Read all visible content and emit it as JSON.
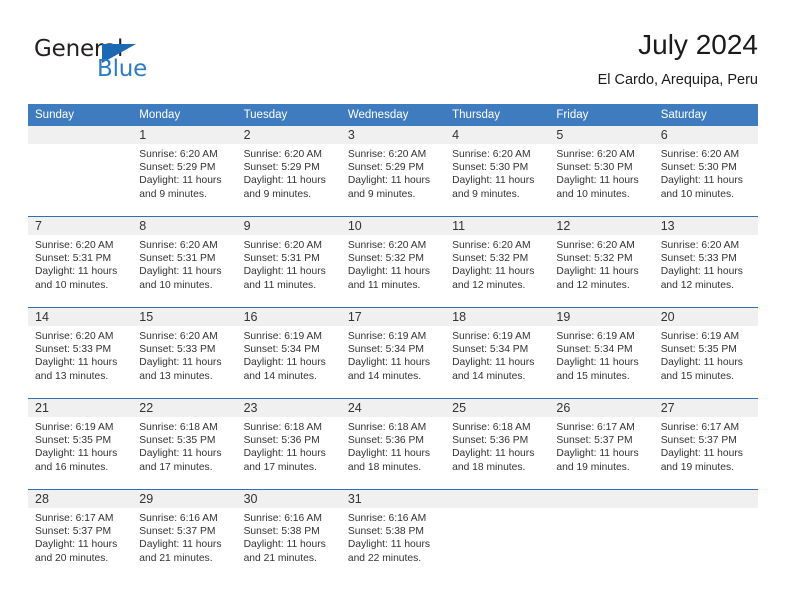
{
  "logo": {
    "primary_text": "General",
    "secondary_text": "Blue",
    "primary_color": "#231f20",
    "secondary_color": "#2b7cc4",
    "triangle_color": "#1b69b3"
  },
  "header": {
    "title": "July 2024",
    "subtitle": "El Cardo, Arequipa, Peru"
  },
  "theme": {
    "header_row_bg": "#3f7cbf",
    "header_row_text": "#ffffff",
    "daynum_bg": "#f0f0f0",
    "row_divider": "#2f6fb3",
    "body_text": "#333333"
  },
  "calendar": {
    "weekday_headers": [
      "Sunday",
      "Monday",
      "Tuesday",
      "Wednesday",
      "Thursday",
      "Friday",
      "Saturday"
    ],
    "weeks": [
      [
        {
          "day": "",
          "empty": true,
          "sunrise": "",
          "sunset": "",
          "daylight_line1": "",
          "daylight_line2": ""
        },
        {
          "day": "1",
          "empty": false,
          "sunrise": "Sunrise: 6:20 AM",
          "sunset": "Sunset: 5:29 PM",
          "daylight_line1": "Daylight: 11 hours",
          "daylight_line2": "and 9 minutes."
        },
        {
          "day": "2",
          "empty": false,
          "sunrise": "Sunrise: 6:20 AM",
          "sunset": "Sunset: 5:29 PM",
          "daylight_line1": "Daylight: 11 hours",
          "daylight_line2": "and 9 minutes."
        },
        {
          "day": "3",
          "empty": false,
          "sunrise": "Sunrise: 6:20 AM",
          "sunset": "Sunset: 5:29 PM",
          "daylight_line1": "Daylight: 11 hours",
          "daylight_line2": "and 9 minutes."
        },
        {
          "day": "4",
          "empty": false,
          "sunrise": "Sunrise: 6:20 AM",
          "sunset": "Sunset: 5:30 PM",
          "daylight_line1": "Daylight: 11 hours",
          "daylight_line2": "and 9 minutes."
        },
        {
          "day": "5",
          "empty": false,
          "sunrise": "Sunrise: 6:20 AM",
          "sunset": "Sunset: 5:30 PM",
          "daylight_line1": "Daylight: 11 hours",
          "daylight_line2": "and 10 minutes."
        },
        {
          "day": "6",
          "empty": false,
          "sunrise": "Sunrise: 6:20 AM",
          "sunset": "Sunset: 5:30 PM",
          "daylight_line1": "Daylight: 11 hours",
          "daylight_line2": "and 10 minutes."
        }
      ],
      [
        {
          "day": "7",
          "empty": false,
          "sunrise": "Sunrise: 6:20 AM",
          "sunset": "Sunset: 5:31 PM",
          "daylight_line1": "Daylight: 11 hours",
          "daylight_line2": "and 10 minutes."
        },
        {
          "day": "8",
          "empty": false,
          "sunrise": "Sunrise: 6:20 AM",
          "sunset": "Sunset: 5:31 PM",
          "daylight_line1": "Daylight: 11 hours",
          "daylight_line2": "and 10 minutes."
        },
        {
          "day": "9",
          "empty": false,
          "sunrise": "Sunrise: 6:20 AM",
          "sunset": "Sunset: 5:31 PM",
          "daylight_line1": "Daylight: 11 hours",
          "daylight_line2": "and 11 minutes."
        },
        {
          "day": "10",
          "empty": false,
          "sunrise": "Sunrise: 6:20 AM",
          "sunset": "Sunset: 5:32 PM",
          "daylight_line1": "Daylight: 11 hours",
          "daylight_line2": "and 11 minutes."
        },
        {
          "day": "11",
          "empty": false,
          "sunrise": "Sunrise: 6:20 AM",
          "sunset": "Sunset: 5:32 PM",
          "daylight_line1": "Daylight: 11 hours",
          "daylight_line2": "and 12 minutes."
        },
        {
          "day": "12",
          "empty": false,
          "sunrise": "Sunrise: 6:20 AM",
          "sunset": "Sunset: 5:32 PM",
          "daylight_line1": "Daylight: 11 hours",
          "daylight_line2": "and 12 minutes."
        },
        {
          "day": "13",
          "empty": false,
          "sunrise": "Sunrise: 6:20 AM",
          "sunset": "Sunset: 5:33 PM",
          "daylight_line1": "Daylight: 11 hours",
          "daylight_line2": "and 12 minutes."
        }
      ],
      [
        {
          "day": "14",
          "empty": false,
          "sunrise": "Sunrise: 6:20 AM",
          "sunset": "Sunset: 5:33 PM",
          "daylight_line1": "Daylight: 11 hours",
          "daylight_line2": "and 13 minutes."
        },
        {
          "day": "15",
          "empty": false,
          "sunrise": "Sunrise: 6:20 AM",
          "sunset": "Sunset: 5:33 PM",
          "daylight_line1": "Daylight: 11 hours",
          "daylight_line2": "and 13 minutes."
        },
        {
          "day": "16",
          "empty": false,
          "sunrise": "Sunrise: 6:19 AM",
          "sunset": "Sunset: 5:34 PM",
          "daylight_line1": "Daylight: 11 hours",
          "daylight_line2": "and 14 minutes."
        },
        {
          "day": "17",
          "empty": false,
          "sunrise": "Sunrise: 6:19 AM",
          "sunset": "Sunset: 5:34 PM",
          "daylight_line1": "Daylight: 11 hours",
          "daylight_line2": "and 14 minutes."
        },
        {
          "day": "18",
          "empty": false,
          "sunrise": "Sunrise: 6:19 AM",
          "sunset": "Sunset: 5:34 PM",
          "daylight_line1": "Daylight: 11 hours",
          "daylight_line2": "and 14 minutes."
        },
        {
          "day": "19",
          "empty": false,
          "sunrise": "Sunrise: 6:19 AM",
          "sunset": "Sunset: 5:34 PM",
          "daylight_line1": "Daylight: 11 hours",
          "daylight_line2": "and 15 minutes."
        },
        {
          "day": "20",
          "empty": false,
          "sunrise": "Sunrise: 6:19 AM",
          "sunset": "Sunset: 5:35 PM",
          "daylight_line1": "Daylight: 11 hours",
          "daylight_line2": "and 15 minutes."
        }
      ],
      [
        {
          "day": "21",
          "empty": false,
          "sunrise": "Sunrise: 6:19 AM",
          "sunset": "Sunset: 5:35 PM",
          "daylight_line1": "Daylight: 11 hours",
          "daylight_line2": "and 16 minutes."
        },
        {
          "day": "22",
          "empty": false,
          "sunrise": "Sunrise: 6:18 AM",
          "sunset": "Sunset: 5:35 PM",
          "daylight_line1": "Daylight: 11 hours",
          "daylight_line2": "and 17 minutes."
        },
        {
          "day": "23",
          "empty": false,
          "sunrise": "Sunrise: 6:18 AM",
          "sunset": "Sunset: 5:36 PM",
          "daylight_line1": "Daylight: 11 hours",
          "daylight_line2": "and 17 minutes."
        },
        {
          "day": "24",
          "empty": false,
          "sunrise": "Sunrise: 6:18 AM",
          "sunset": "Sunset: 5:36 PM",
          "daylight_line1": "Daylight: 11 hours",
          "daylight_line2": "and 18 minutes."
        },
        {
          "day": "25",
          "empty": false,
          "sunrise": "Sunrise: 6:18 AM",
          "sunset": "Sunset: 5:36 PM",
          "daylight_line1": "Daylight: 11 hours",
          "daylight_line2": "and 18 minutes."
        },
        {
          "day": "26",
          "empty": false,
          "sunrise": "Sunrise: 6:17 AM",
          "sunset": "Sunset: 5:37 PM",
          "daylight_line1": "Daylight: 11 hours",
          "daylight_line2": "and 19 minutes."
        },
        {
          "day": "27",
          "empty": false,
          "sunrise": "Sunrise: 6:17 AM",
          "sunset": "Sunset: 5:37 PM",
          "daylight_line1": "Daylight: 11 hours",
          "daylight_line2": "and 19 minutes."
        }
      ],
      [
        {
          "day": "28",
          "empty": false,
          "sunrise": "Sunrise: 6:17 AM",
          "sunset": "Sunset: 5:37 PM",
          "daylight_line1": "Daylight: 11 hours",
          "daylight_line2": "and 20 minutes."
        },
        {
          "day": "29",
          "empty": false,
          "sunrise": "Sunrise: 6:16 AM",
          "sunset": "Sunset: 5:37 PM",
          "daylight_line1": "Daylight: 11 hours",
          "daylight_line2": "and 21 minutes."
        },
        {
          "day": "30",
          "empty": false,
          "sunrise": "Sunrise: 6:16 AM",
          "sunset": "Sunset: 5:38 PM",
          "daylight_line1": "Daylight: 11 hours",
          "daylight_line2": "and 21 minutes."
        },
        {
          "day": "31",
          "empty": false,
          "sunrise": "Sunrise: 6:16 AM",
          "sunset": "Sunset: 5:38 PM",
          "daylight_line1": "Daylight: 11 hours",
          "daylight_line2": "and 22 minutes."
        },
        {
          "day": "",
          "empty": true,
          "sunrise": "",
          "sunset": "",
          "daylight_line1": "",
          "daylight_line2": ""
        },
        {
          "day": "",
          "empty": true,
          "sunrise": "",
          "sunset": "",
          "daylight_line1": "",
          "daylight_line2": ""
        },
        {
          "day": "",
          "empty": true,
          "sunrise": "",
          "sunset": "",
          "daylight_line1": "",
          "daylight_line2": ""
        }
      ]
    ]
  }
}
